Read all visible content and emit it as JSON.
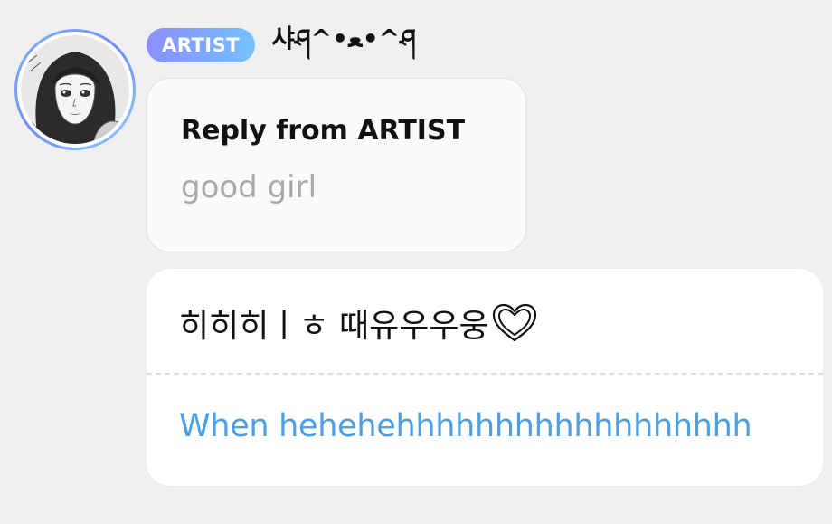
{
  "header": {
    "badge_label": "ARTIST",
    "username": "샤ཤ^•ﻌ•^ཤ"
  },
  "reply": {
    "title": "Reply from ARTIST",
    "text": "good girl"
  },
  "message": {
    "original_text": "히히히ㅣㅎ 때유우우웅",
    "heart_icon": "heart-outline-icon",
    "translation_text": "When hehehehhhhhhhhhhhhhhhhhh"
  },
  "colors": {
    "background": "#efefef",
    "badge_gradient_start": "#8d8fff",
    "badge_gradient_end": "#76c2ff",
    "translation_text": "#4d9fe3",
    "reply_text": "#aaaaaa"
  }
}
